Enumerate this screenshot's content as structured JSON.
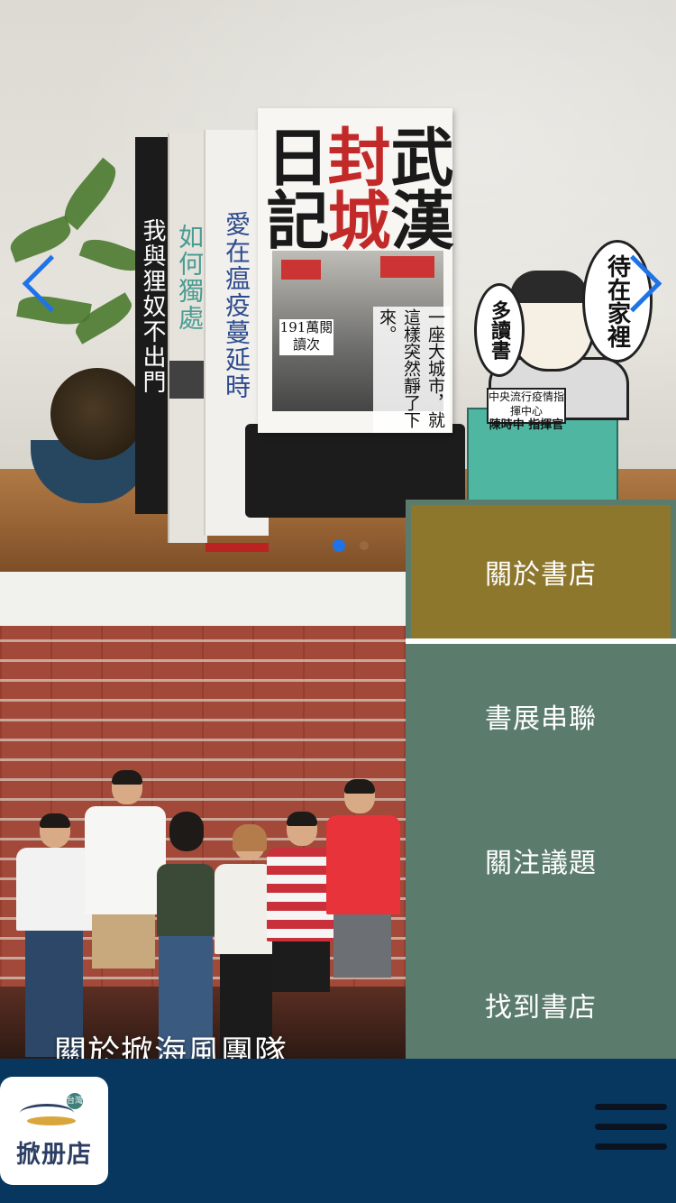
{
  "hero": {
    "slide_count": 2,
    "active_slide": 1,
    "books": {
      "spine_1": "我與狸奴不出門",
      "spine_2": "如何獨處",
      "spine_3": "愛在瘟疫蔓延時",
      "main_title_col1": "武漢",
      "main_title_col2": "封城",
      "main_title_col3": "日記",
      "main_badge": "191萬閱讀次",
      "main_side": "一座大城市，就這樣突然靜了下來。"
    },
    "cartoon": {
      "bubble_left": "多讀書",
      "bubble_right": "待在家裡",
      "nameplate_org": "中央流行疫情指揮中心",
      "nameplate_name": "陳時中 指揮官"
    }
  },
  "menu": {
    "items": [
      {
        "label": "關於書店",
        "active": true
      },
      {
        "label": "書展串聯",
        "active": false
      },
      {
        "label": "關注議題",
        "active": false
      },
      {
        "label": "找到書店",
        "active": false
      }
    ]
  },
  "team": {
    "title": "關於掀海風團隊"
  },
  "footer": {
    "logo_text": "掀册店",
    "logo_stamp": "台灣"
  },
  "colors": {
    "footer_bg": "#07375f",
    "menu_bg": "#5b7c6d",
    "menu_active": "#8d772c",
    "slider_accent": "#1e73e8"
  },
  "icons": {
    "prev": "chevron-left-icon",
    "next": "chevron-right-icon",
    "menu": "hamburger-icon"
  }
}
